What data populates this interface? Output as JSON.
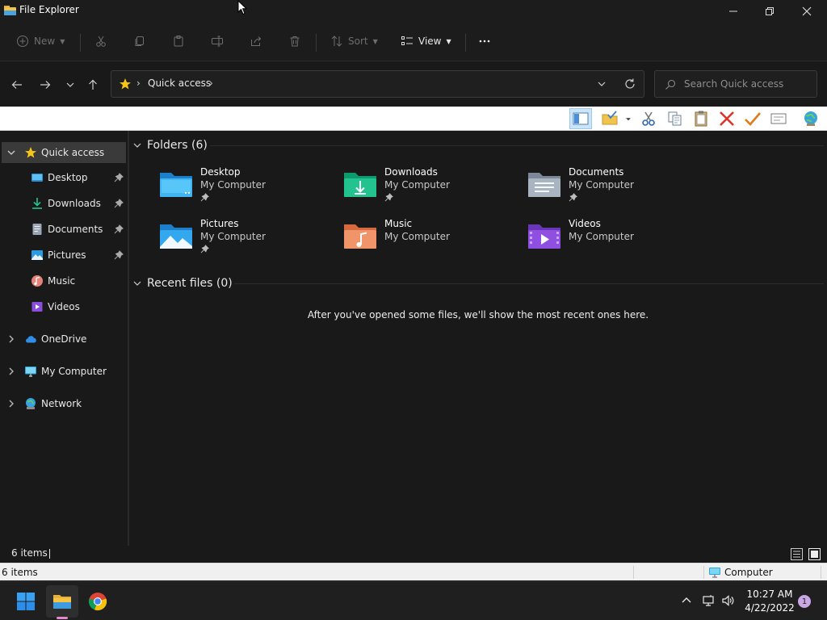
{
  "window": {
    "title": "File Explorer"
  },
  "commandbar": {
    "new_label": "New",
    "sort_label": "Sort",
    "view_label": "View"
  },
  "address": {
    "location": "Quick access"
  },
  "search": {
    "placeholder": "Search Quick access"
  },
  "sidebar": {
    "quick_access": "Quick access",
    "items": [
      {
        "label": "Desktop"
      },
      {
        "label": "Downloads"
      },
      {
        "label": "Documents"
      },
      {
        "label": "Pictures"
      },
      {
        "label": "Music"
      },
      {
        "label": "Videos"
      }
    ],
    "onedrive": "OneDrive",
    "my_computer": "My Computer",
    "network": "Network"
  },
  "content": {
    "folders_header": "Folders (6)",
    "recent_header": "Recent files (0)",
    "empty_message": "After you've opened some files, we'll show the most recent ones here.",
    "folders": [
      {
        "name": "Desktop",
        "location": "My Computer",
        "pinned": true
      },
      {
        "name": "Downloads",
        "location": "My Computer",
        "pinned": true
      },
      {
        "name": "Documents",
        "location": "My Computer",
        "pinned": true
      },
      {
        "name": "Pictures",
        "location": "My Computer",
        "pinned": true
      },
      {
        "name": "Music",
        "location": "My Computer",
        "pinned": false
      },
      {
        "name": "Videos",
        "location": "My Computer",
        "pinned": false
      }
    ]
  },
  "status": {
    "item_count": "6 items",
    "item_count_classic": "6 items",
    "zone": "Computer"
  },
  "taskbar": {
    "time": "10:27 AM",
    "date": "4/22/2022",
    "notifications": "1"
  },
  "colors": {
    "background": "#191919",
    "chrome": "#1c1c1c",
    "selected": "#3a3a3a",
    "accent_star": "#f5c518"
  }
}
